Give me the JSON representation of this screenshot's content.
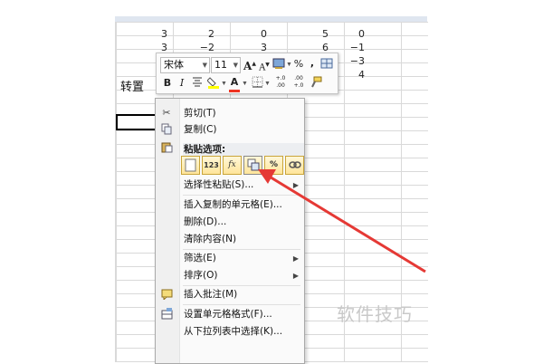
{
  "sheet": {
    "rows": [
      [
        "3",
        "2",
        "0",
        "5",
        "0"
      ],
      [
        "3",
        "−2",
        "3",
        "6",
        "−1"
      ],
      [
        "",
        "",
        "",
        "",
        "−3"
      ],
      [
        "",
        "",
        "",
        "",
        "4"
      ]
    ],
    "transpose_label": "转置"
  },
  "mini_toolbar": {
    "font_name": "宋体",
    "font_size": "11",
    "grow_font": "A",
    "shrink_font": "A",
    "percent": "%",
    "comma": ",",
    "bold": "B",
    "italic": "I",
    "font_color": "A",
    "dec_increase": "+.0\n.00",
    "dec_decrease": ".00\n+.0"
  },
  "context_menu": {
    "cut": "剪切(T)",
    "copy": "复制(C)",
    "paste_options": "粘贴选项:",
    "paste_special": "选择性粘贴(S)...",
    "insert_copied_cells": "插入复制的单元格(E)...",
    "delete": "删除(D)...",
    "clear_contents": "清除内容(N)",
    "filter": "筛选(E)",
    "sort": "排序(O)",
    "insert_comment": "插入批注(M)",
    "format_cells": "设置单元格格式(F)...",
    "pick_from_list": "从下拉列表中选择(K)..."
  },
  "paste_buttons": {
    "values": "123",
    "formulas": "fx",
    "percent": "%"
  },
  "watermark": "软件技巧",
  "colors": {
    "arrow": "#e53935",
    "menu_bg": "#fafafa",
    "gutter_bg": "#f0f0f0",
    "paste_btn": "#ffe59a"
  }
}
